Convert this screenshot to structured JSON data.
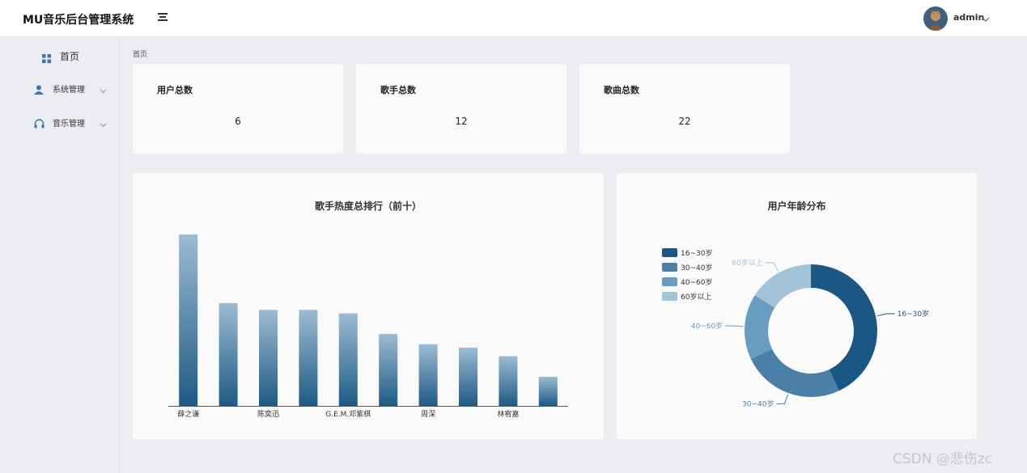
{
  "app": {
    "title": "MU音乐后台管理系统"
  },
  "header": {
    "user_name": "admin"
  },
  "sidebar": {
    "items": [
      {
        "label": "首页",
        "icon": "grid-icon"
      },
      {
        "label": "系统管理",
        "icon": "user-icon"
      },
      {
        "label": "音乐管理",
        "icon": "headphones-icon"
      }
    ]
  },
  "breadcrumb": {
    "current": "首页"
  },
  "stats": [
    {
      "title": "用户总数",
      "value": "6"
    },
    {
      "title": "歌手总数",
      "value": "12"
    },
    {
      "title": "歌曲总数",
      "value": "22"
    }
  ],
  "bar_panel": {
    "title": "歌手热度总排行（前十）"
  },
  "pie_panel": {
    "title": "用户年龄分布"
  },
  "chart_data": [
    {
      "type": "bar",
      "title": "歌手热度总排行（前十）",
      "categories": [
        "薛之谦",
        "",
        "陈奕迅",
        "",
        "G.E.M.邓紫棋",
        "",
        "周深",
        "",
        "林宥嘉",
        ""
      ],
      "values": [
        100,
        60,
        56,
        56,
        54,
        42,
        36,
        34,
        29,
        17
      ],
      "ylim": [
        0,
        100
      ],
      "grid": false,
      "bar_color_top": "#9dbbd3",
      "bar_color_bottom": "#1e5a85"
    },
    {
      "type": "pie",
      "title": "用户年龄分布",
      "legend_position": "top-left",
      "slices": [
        {
          "label": "16~30岁",
          "value": 43,
          "color": "#1b5784"
        },
        {
          "label": "30~40岁",
          "value": 25,
          "color": "#4a7fa8"
        },
        {
          "label": "40~60岁",
          "value": 16,
          "color": "#6a9bc1"
        },
        {
          "label": "60岁以上",
          "value": 16,
          "color": "#a2c3d8"
        }
      ]
    }
  ],
  "watermark": "CSDN @悲伤zc"
}
